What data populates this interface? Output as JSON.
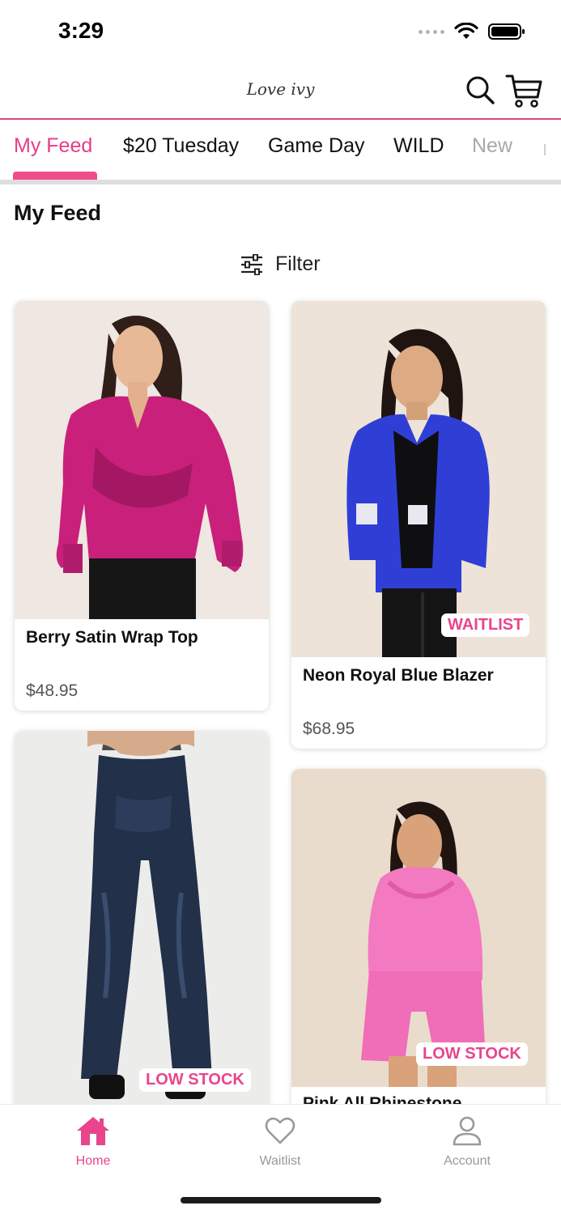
{
  "status_bar": {
    "time": "3:29"
  },
  "header": {
    "logo_text": "Love ivy"
  },
  "tabs": [
    {
      "label": "My Feed"
    },
    {
      "label": "$20 Tuesday"
    },
    {
      "label": "Game Day"
    },
    {
      "label": "WILD"
    },
    {
      "label": "New"
    }
  ],
  "section": {
    "title": "My Feed",
    "filter_label": "Filter"
  },
  "products": [
    {
      "title": "Berry Satin Wrap Top",
      "price": "$48.95",
      "badge": ""
    },
    {
      "title": "Neon Royal Blue Blazer",
      "price": "$68.95",
      "badge": "WAITLIST"
    },
    {
      "title": "",
      "price": "",
      "badge": "LOW STOCK"
    },
    {
      "title": "Pink All Rhinestone",
      "price": "",
      "badge": "LOW STOCK"
    }
  ],
  "bottom_nav": {
    "items": [
      {
        "label": "Home",
        "icon": "home-icon"
      },
      {
        "label": "Waitlist",
        "icon": "heart-icon"
      },
      {
        "label": "Account",
        "icon": "person-icon"
      }
    ]
  },
  "colors": {
    "accent": "#e8458b",
    "text": "#111111",
    "muted": "#999999"
  }
}
